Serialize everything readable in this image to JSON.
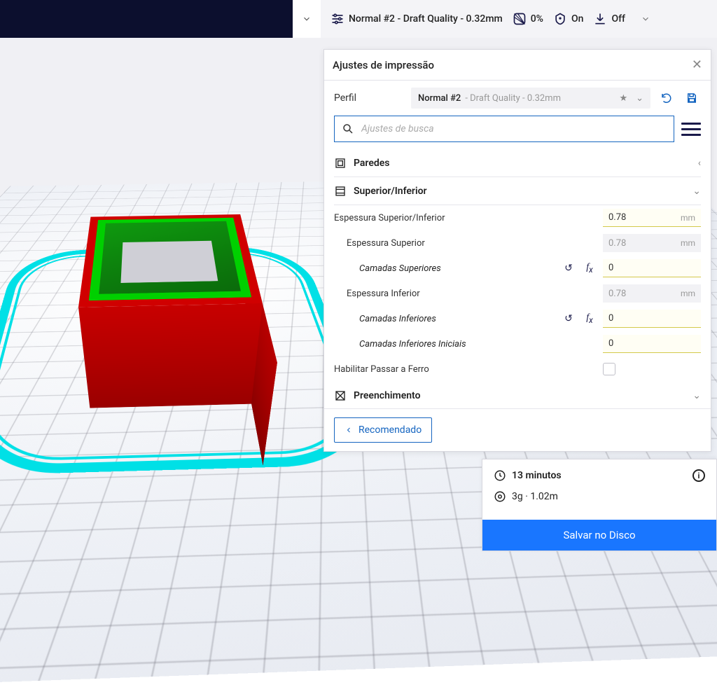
{
  "top": {
    "profile_summary": "Normal #2 - Draft Quality - 0.32mm",
    "infill_pct": "0%",
    "support_label": "On",
    "adhesion_label": "Off"
  },
  "panel": {
    "title": "Ajustes de impressão",
    "profile_label": "Perfil",
    "profile_name": "Normal #2",
    "profile_desc": " - Draft Quality - 0.32mm",
    "search_placeholder": "Ajustes de busca",
    "sections": {
      "walls": "Paredes",
      "topbottom": "Superior/Inferior",
      "infill": "Preenchimento"
    },
    "settings": {
      "tb_thickness": {
        "label": "Espessura Superior/Inferior",
        "value": "0.78",
        "unit": "mm"
      },
      "top_thickness": {
        "label": "Espessura Superior",
        "value": "0.78",
        "unit": "mm"
      },
      "top_layers": {
        "label": "Camadas Superiores",
        "value": "0"
      },
      "bottom_thickness": {
        "label": "Espessura Inferior",
        "value": "0.78",
        "unit": "mm"
      },
      "bottom_layers": {
        "label": "Camadas Inferiores",
        "value": "0"
      },
      "initial_bottom_layers": {
        "label": "Camadas Inferiores Iniciais",
        "value": "0"
      },
      "ironing": {
        "label": "Habilitar Passar a Ferro"
      }
    },
    "recommended_btn": "Recomendado"
  },
  "bottom": {
    "time": "13 minutos",
    "material": "3g · 1.02m",
    "save_btn": "Salvar no Disco"
  }
}
